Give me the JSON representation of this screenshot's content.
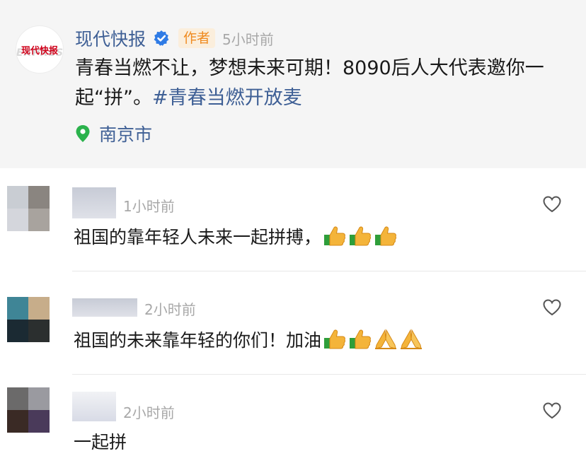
{
  "post": {
    "author": "现代快报",
    "author_badge": "作者",
    "time": "5小时前",
    "text": "青春当燃不让，梦想未来可期！8090后人大代表邀你一起“拼”。",
    "hashtag": "#青春当燃开放麦",
    "location": "南京市",
    "logo_text": "现代快报"
  },
  "comments": [
    {
      "time": "1小时前",
      "text": "祖国的靠年轻人未来一起拼搏，",
      "emojis": [
        "thumbs-up",
        "thumbs-up",
        "thumbs-up"
      ],
      "avatar_colors": [
        "#c9cdd3",
        "#8a8580",
        "#d4d6dc",
        "#a8a39e"
      ]
    },
    {
      "time": "2小时前",
      "text": "祖国的未来靠年轻的你们！加油",
      "emojis": [
        "thumbs-up",
        "thumbs-up",
        "pray",
        "pray"
      ],
      "avatar_colors": [
        "#3f8596",
        "#c7ad8a",
        "#1b2a33",
        "#2b2f2f"
      ]
    },
    {
      "time": "2小时前",
      "text": "一起拼",
      "emojis": [],
      "avatar_colors": [
        "#6b6a6a",
        "#9a9aa0",
        "#3a2a25",
        "#4a3a5a"
      ]
    }
  ],
  "colors": {
    "link": "#3e5f95",
    "badge_text": "#ef8a1f",
    "badge_bg": "#fbeedc",
    "location_pin": "#2bb24c",
    "verified": "#2f7be5"
  }
}
